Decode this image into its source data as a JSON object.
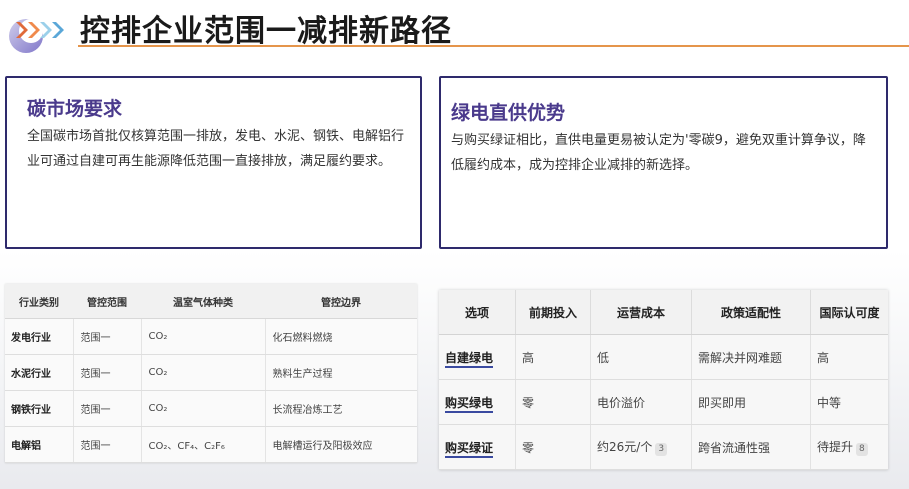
{
  "title": "控排企业范围一减排新路径",
  "colors": {
    "accent": "#e5954b",
    "card_border": "#2e2a6c",
    "heading": "#4a3a8c"
  },
  "cards": [
    {
      "heading": "碳市场要求",
      "body": "全国碳市场首批仅核算范围一排放，发电、水泥、钢铁、电解铝行业可通过自建可再生能源降低范围一直接排放，满足履约要求。"
    },
    {
      "heading": "绿电直供优势",
      "body": "与购买绿证相比，直供电量更易被认定为'零碳9，避免双重计算争议，降低履约成本，成为控排企业减排的新选择。"
    }
  ],
  "industry_table": {
    "headers": [
      "行业类别",
      "管控范围",
      "温室气体种类",
      "管控边界"
    ],
    "rows": [
      [
        "发电行业",
        "范围一",
        "CO₂",
        "化石燃料燃烧"
      ],
      [
        "水泥行业",
        "范围一",
        "CO₂",
        "熟料生产过程"
      ],
      [
        "钢铁行业",
        "范围一",
        "CO₂",
        "长流程冶炼工艺"
      ],
      [
        "电解铝",
        "范围一",
        "CO₂、CF₄、C₂F₆",
        "电解槽运行及阳极效应"
      ]
    ]
  },
  "option_table": {
    "headers": [
      "选项",
      "前期投入",
      "运营成本",
      "政策适配性",
      "国际认可度"
    ],
    "rows": [
      {
        "cells": [
          "自建绿电",
          "高",
          "低",
          "需解决并网难题",
          "高"
        ],
        "badges": {}
      },
      {
        "cells": [
          "购买绿电",
          "零",
          "电价溢价",
          "即买即用",
          "中等"
        ],
        "badges": {}
      },
      {
        "cells": [
          "购买绿证",
          "零",
          "约26元/个",
          "跨省流通性强",
          "待提升"
        ],
        "badges": {
          "2": "3",
          "4": "8"
        }
      }
    ]
  }
}
